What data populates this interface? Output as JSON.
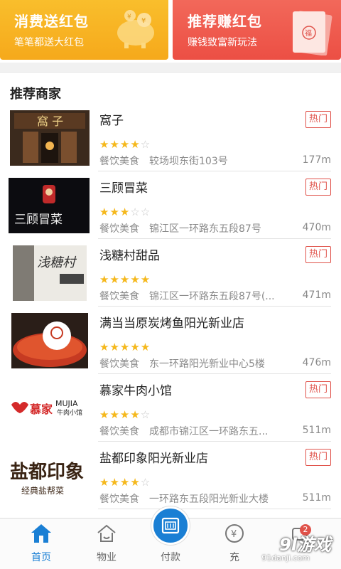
{
  "promos": [
    {
      "title": "消费送红包",
      "subtitle": "笔笔都送大红包",
      "bg": "#f6ab1e"
    },
    {
      "title": "推荐赚红包",
      "subtitle": "赚钱致富新玩法",
      "bg": "#ee564a"
    }
  ],
  "section_title": "推荐商家",
  "hot_label": "热门",
  "merchants": [
    {
      "name": "窩子",
      "stars": "★★★★",
      "stars_off": "☆",
      "rating": 4,
      "category": "餐饮美食",
      "address": "较场坝东街103号",
      "distance": "177m",
      "hot": true
    },
    {
      "name": "三顾冒菜",
      "stars": "★★★",
      "stars_off": "☆☆",
      "rating": 3,
      "category": "餐饮美食",
      "address": "锦江区一环路东五段87号",
      "distance": "470m",
      "hot": true
    },
    {
      "name": "浅糖村甜品",
      "stars": "★★★★★",
      "stars_off": "",
      "rating": 5,
      "category": "餐饮美食",
      "address": "锦江区一环路东五段87号(...",
      "distance": "471m",
      "hot": true
    },
    {
      "name": "满当当原炭烤鱼阳光新业店",
      "stars": "★★★★★",
      "stars_off": "",
      "rating": 5,
      "category": "餐饮美食",
      "address": "东一环路阳光新业中心5楼",
      "distance": "476m",
      "hot": false
    },
    {
      "name": "慕家牛肉小馆",
      "stars": "★★★★",
      "stars_off": "☆",
      "rating": 4,
      "category": "餐饮美食",
      "address": "成都市锦江区一环路东五...",
      "distance": "511m",
      "hot": true
    },
    {
      "name": "盐都印象阳光新业店",
      "stars": "★★★★",
      "stars_off": "☆",
      "rating": 4,
      "category": "餐饮美食",
      "address": "一环路东五段阳光新业大楼",
      "distance": "511m",
      "hot": true
    }
  ],
  "thumb_text": {
    "mujia_cn": "慕家",
    "mujia_en": "MUJIA",
    "mujia_sub": "牛肉小馆",
    "yandu": "盐都印象",
    "yandu_sub": "经典盐帮菜",
    "sangu": "三顾冒菜"
  },
  "nav": [
    {
      "label": "首页",
      "icon": "home-icon",
      "active": true
    },
    {
      "label": "物业",
      "icon": "property-icon",
      "active": false
    },
    {
      "label": "付款",
      "icon": "payment-card-icon",
      "active": false
    },
    {
      "label": "充",
      "icon": "recharge-icon",
      "active": false
    },
    {
      "label": "",
      "icon": "message-icon",
      "active": false
    }
  ],
  "badge_count": "2",
  "watermark": {
    "main": "9l游戏",
    "sub": "91danji.com"
  },
  "colors": {
    "accent": "#1a7fd4",
    "hot": "#e0524a",
    "star": "#f5b81c"
  }
}
